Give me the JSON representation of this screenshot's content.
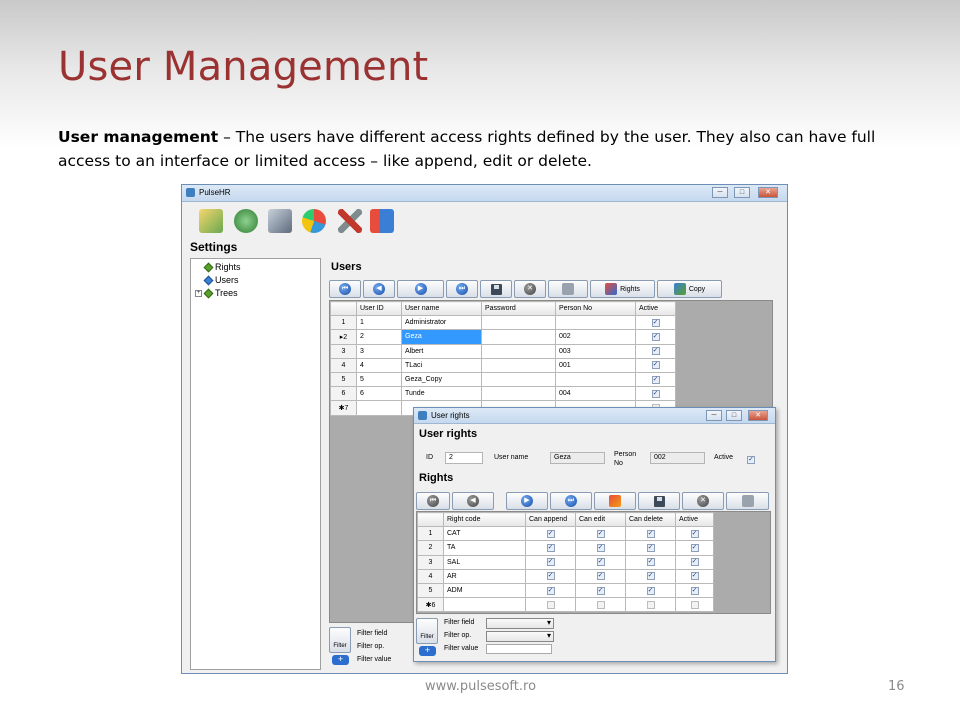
{
  "slide": {
    "title": "User Management",
    "text_bold": "User management",
    "text_rest": " – The users have different access rights defined by the user. They also can have full access to an interface or limited access – like append, edit or delete.",
    "footer_url": "www.pulsesoft.ro",
    "page_number": "16"
  },
  "app": {
    "window_title": "PulseHR",
    "window_controls": [
      "─",
      "□",
      "✕"
    ],
    "settings_label": "Settings",
    "tree_items": [
      "Rights",
      "Users",
      "Trees"
    ],
    "users_label": "Users",
    "toolbar": {
      "rights_label": "Rights",
      "copy_label": "Copy"
    },
    "users_grid": {
      "columns": [
        "User ID",
        "User name",
        "Password",
        "Person No",
        "Active"
      ],
      "rows": [
        {
          "row": "1",
          "id": "1",
          "name": "Administrator",
          "password": "",
          "person_no": "",
          "active": true
        },
        {
          "row": "2",
          "id": "2",
          "name": "Geza",
          "password": "",
          "person_no": "002",
          "active": true,
          "selected": true
        },
        {
          "row": "3",
          "id": "3",
          "name": "Albert",
          "password": "",
          "person_no": "003",
          "active": true
        },
        {
          "row": "4",
          "id": "4",
          "name": "TLaci",
          "password": "",
          "person_no": "001",
          "active": true
        },
        {
          "row": "5",
          "id": "5",
          "name": "Geza_Copy",
          "password": "",
          "person_no": "",
          "active": true
        },
        {
          "row": "6",
          "id": "6",
          "name": "Tunde",
          "password": "",
          "person_no": "004",
          "active": true
        },
        {
          "row": "✱7",
          "id": "",
          "name": "",
          "password": "",
          "person_no": "",
          "active": false
        }
      ]
    },
    "filter": {
      "button_label": "Filter",
      "field_label": "Filter field",
      "op_label": "Filter op.",
      "value_label": "Filter value"
    }
  },
  "dialog": {
    "title": "User rights",
    "heading": "User rights",
    "id_label": "ID",
    "id_value": "2",
    "user_name_label": "User name",
    "user_name_value": "Geza",
    "person_no_label": "Person No",
    "person_no_value": "002",
    "active_label": "Active",
    "rights_heading": "Rights",
    "rights_grid": {
      "columns": [
        "Right code",
        "Can append",
        "Can edit",
        "Can delete",
        "Active"
      ],
      "rows": [
        {
          "row": "1",
          "code": "CAT",
          "append": true,
          "edit": true,
          "delete": true,
          "active": true
        },
        {
          "row": "2",
          "code": "TA",
          "append": true,
          "edit": true,
          "delete": true,
          "active": true
        },
        {
          "row": "3",
          "code": "SAL",
          "append": true,
          "edit": true,
          "delete": true,
          "active": true
        },
        {
          "row": "4",
          "code": "AR",
          "append": true,
          "edit": true,
          "delete": true,
          "active": true
        },
        {
          "row": "5",
          "code": "ADM",
          "append": true,
          "edit": true,
          "delete": true,
          "active": true
        },
        {
          "row": "✱6",
          "code": "",
          "append": false,
          "edit": false,
          "delete": false,
          "active": false
        }
      ]
    },
    "filter": {
      "button_label": "Filter",
      "field_label": "Filter field",
      "op_label": "Filter op.",
      "value_label": "Filter value"
    }
  },
  "colors": {
    "title_red": "#9b3232",
    "selection_blue": "#3399ff",
    "window_border": "#6d8fb5"
  }
}
